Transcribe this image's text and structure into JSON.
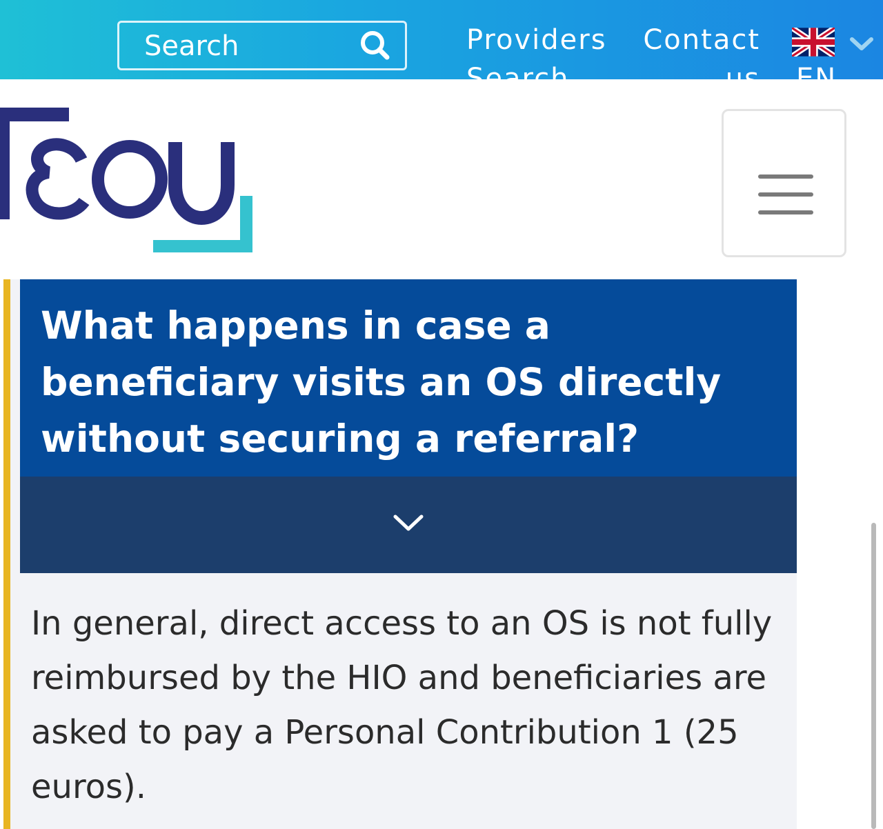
{
  "topbar": {
    "search": {
      "placeholder": "Search",
      "icon": "search-icon"
    },
    "nav": {
      "providers_label": "Providers Search",
      "contact_label": "Contact us"
    },
    "language": {
      "flag_icon": "uk-flag-icon",
      "label": "EN",
      "chevron_icon": "chevron-down-icon"
    },
    "colors": {
      "gradient_start": "#1fc0d6",
      "gradient_end": "#1b86e2"
    }
  },
  "header": {
    "logo_text": "ΓΕΣΥ",
    "menu_icon": "hamburger-menu-icon"
  },
  "faq": {
    "question": "What happens in case a beneficiary visits an OS directly without securing a referral?",
    "toggle_icon": "chevron-down-icon",
    "answer": "In general, direct access to an OS is not fully reimbursed by the HIO and beneficiaries are asked to pay a Personal Contribution 1 (25 euros).",
    "colors": {
      "question_bg": "#054b9a",
      "toggle_bg": "#1c3e6c",
      "accent_border": "#e8b522",
      "answer_bg": "#f2f3f7"
    }
  }
}
